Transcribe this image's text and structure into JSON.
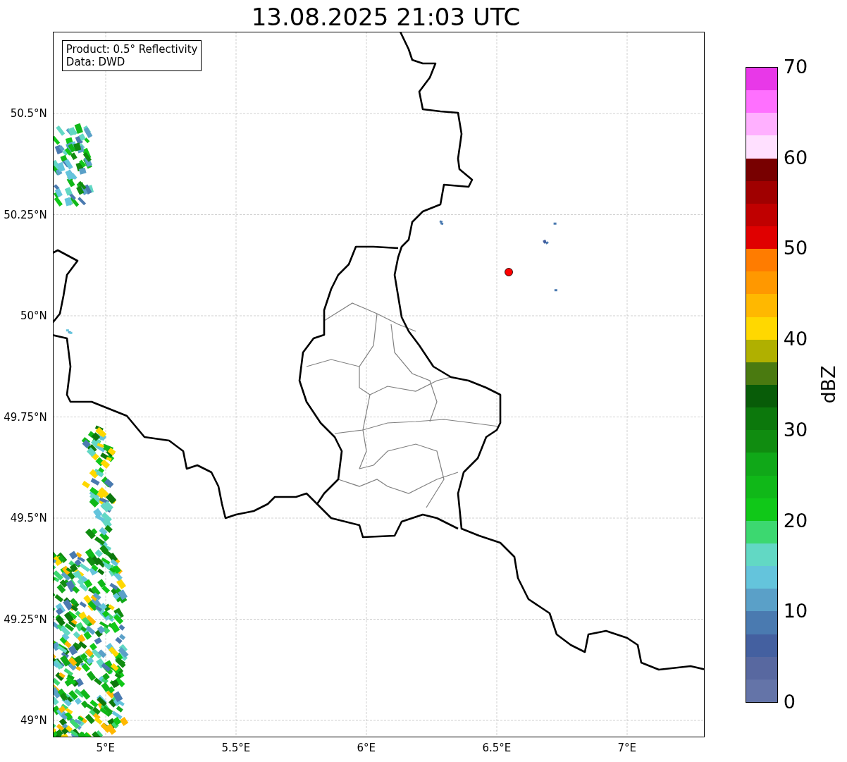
{
  "title": "13.08.2025 21:03 UTC",
  "legend": {
    "lines": [
      "Product: 0.5° Reflectivity",
      "Data: DWD"
    ]
  },
  "map": {
    "lat_labels": [
      "50.5°N",
      "50.25°N",
      "50°N",
      "49.75°N",
      "49.5°N",
      "49.25°N",
      "49°N"
    ],
    "lon_labels": [
      "5°E",
      "5.5°E",
      "6°E",
      "6.5°E",
      "7°E"
    ]
  },
  "colorbar": {
    "label": "dBZ",
    "ticks": [
      "70",
      "60",
      "50",
      "40",
      "30",
      "20",
      "10",
      "0"
    ],
    "bands": [
      {
        "color": "#6474a8"
      },
      {
        "color": "#5868a0"
      },
      {
        "color": "#4460a0"
      },
      {
        "color": "#4a7ab0"
      },
      {
        "color": "#5aa0c8"
      },
      {
        "color": "#64c4dc"
      },
      {
        "color": "#62d8c4"
      },
      {
        "color": "#3cd870"
      },
      {
        "color": "#10c818"
      },
      {
        "color": "#10b818"
      },
      {
        "color": "#10a818"
      },
      {
        "color": "#108c10"
      },
      {
        "color": "#0c780c"
      },
      {
        "color": "#085c08"
      },
      {
        "color": "#4a7a10"
      },
      {
        "color": "#b0b000"
      },
      {
        "color": "#ffd800"
      },
      {
        "color": "#ffb800"
      },
      {
        "color": "#ff9800"
      },
      {
        "color": "#ff7c00"
      },
      {
        "color": "#e00000"
      },
      {
        "color": "#c00000"
      },
      {
        "color": "#a00000"
      },
      {
        "color": "#780000"
      },
      {
        "color": "#ffe0ff"
      },
      {
        "color": "#ffb0ff"
      },
      {
        "color": "#ff70ff"
      },
      {
        "color": "#e838e8"
      }
    ]
  }
}
